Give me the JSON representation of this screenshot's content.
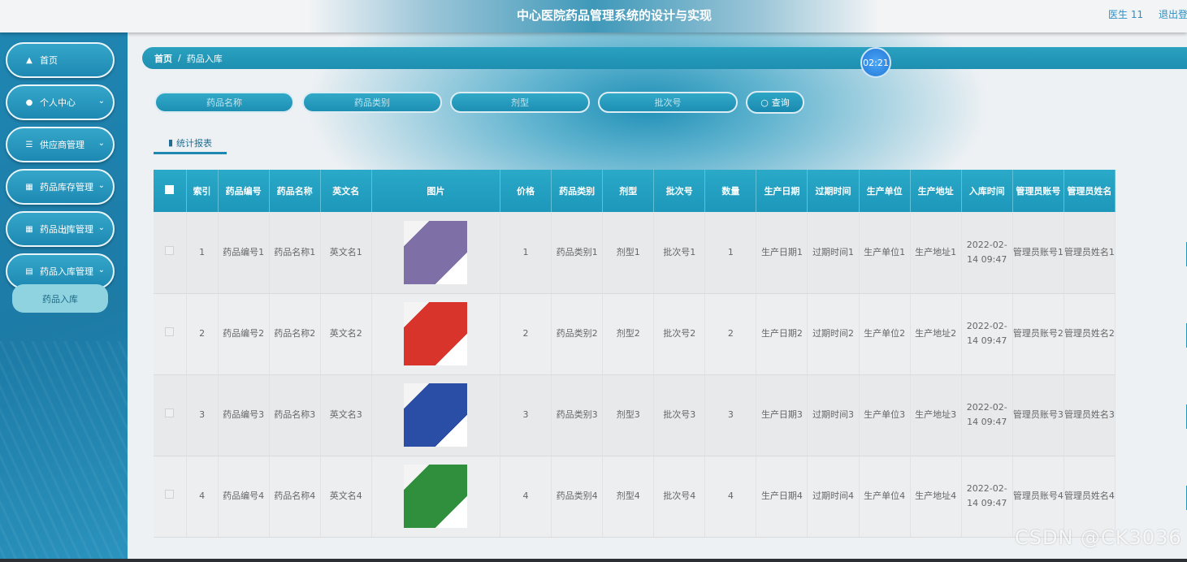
{
  "header": {
    "title": "中心医院药品管理系统的设计与实现",
    "user": "医生 11",
    "logout": "退出登"
  },
  "sidebar": {
    "items": [
      {
        "label": "首页",
        "icon": "home-icon"
      },
      {
        "label": "个人中心",
        "icon": "user-icon"
      },
      {
        "label": "供应商管理",
        "icon": "list-icon"
      },
      {
        "label": "药品库存管理",
        "icon": "grid-icon"
      },
      {
        "label": "药品出库管理",
        "icon": "grid-icon"
      },
      {
        "label": "药品入库管理",
        "icon": "briefcase-icon"
      }
    ],
    "sub_item": "药品入库"
  },
  "breadcrumb": {
    "home": "首页",
    "separator": "/",
    "current": "药品入库"
  },
  "timer": "02:21",
  "search": {
    "name_placeholder": "药品名称",
    "category_placeholder": "药品类别",
    "form_placeholder": "剂型",
    "batch_placeholder": "批次号",
    "query_label": "查询"
  },
  "tab": {
    "report_label": "统计报表"
  },
  "table": {
    "headers": [
      "索引",
      "药品编号",
      "药品名称",
      "英文名",
      "图片",
      "价格",
      "药品类别",
      "剂型",
      "批次号",
      "数量",
      "生产日期",
      "过期时间",
      "生产单位",
      "生产地址",
      "入库时间",
      "管理员账号",
      "管理员姓名"
    ],
    "rows": [
      {
        "index": "1",
        "code": "药品编号1",
        "name": "药品名称1",
        "english": "英文名1",
        "image": "medicine-box-purple",
        "price": "1",
        "category": "药品类别1",
        "form": "剂型1",
        "batch": "批次号1",
        "qty": "1",
        "mfg_date": "生产日期1",
        "expiry": "过期时间1",
        "maker": "生产单位1",
        "address": "生产地址1",
        "in_time": "2022-02-14 09:47",
        "admin_account": "管理员账号1",
        "admin_name": "管理员姓名1"
      },
      {
        "index": "2",
        "code": "药品编号2",
        "name": "药品名称2",
        "english": "英文名2",
        "image": "medicine-box-red",
        "price": "2",
        "category": "药品类别2",
        "form": "剂型2",
        "batch": "批次号2",
        "qty": "2",
        "mfg_date": "生产日期2",
        "expiry": "过期时间2",
        "maker": "生产单位2",
        "address": "生产地址2",
        "in_time": "2022-02-14 09:47",
        "admin_account": "管理员账号2",
        "admin_name": "管理员姓名2"
      },
      {
        "index": "3",
        "code": "药品编号3",
        "name": "药品名称3",
        "english": "英文名3",
        "image": "medicine-box-blue",
        "price": "3",
        "category": "药品类别3",
        "form": "剂型3",
        "batch": "批次号3",
        "qty": "3",
        "mfg_date": "生产日期3",
        "expiry": "过期时间3",
        "maker": "生产单位3",
        "address": "生产地址3",
        "in_time": "2022-02-14 09:47",
        "admin_account": "管理员账号3",
        "admin_name": "管理员姓名3"
      },
      {
        "index": "4",
        "code": "药品编号4",
        "name": "药品名称4",
        "english": "英文名4",
        "image": "medicine-box-green",
        "price": "4",
        "category": "药品类别4",
        "form": "剂型4",
        "batch": "批次号4",
        "qty": "4",
        "mfg_date": "生产日期4",
        "expiry": "过期时间4",
        "maker": "生产单位4",
        "address": "生产地址4",
        "in_time": "2022-02-14 09:47",
        "admin_account": "管理员账号4",
        "admin_name": "管理员姓名4"
      }
    ]
  },
  "thumb_colors": {
    "purple": "#7e6fa6",
    "red": "#d8342b",
    "blue": "#2a4ea5",
    "green": "#2f8f3c"
  },
  "watermark": "CSDN @CK3036"
}
